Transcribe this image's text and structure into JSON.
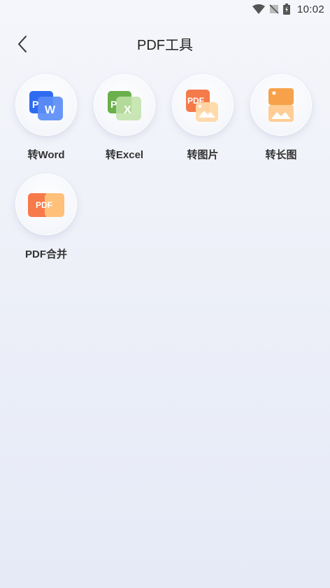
{
  "status_bar": {
    "time": "10:02"
  },
  "header": {
    "title": "PDF工具"
  },
  "tools": [
    {
      "label": "转Word",
      "icon_text": "P",
      "icon_text2": "W"
    },
    {
      "label": "转Excel",
      "icon_text": "P",
      "icon_text2": "X"
    },
    {
      "label": "转图片",
      "icon_text": "PDF"
    },
    {
      "label": "转长图"
    },
    {
      "label": "PDF合并",
      "icon_text": "PDF"
    }
  ],
  "colors": {
    "word_blue": "#2f6bf0",
    "excel_green": "#6ab04c",
    "image_orange": "#f57a4a",
    "longimg_orange": "#f7a24a",
    "merge_orange": "#f77a4a"
  }
}
